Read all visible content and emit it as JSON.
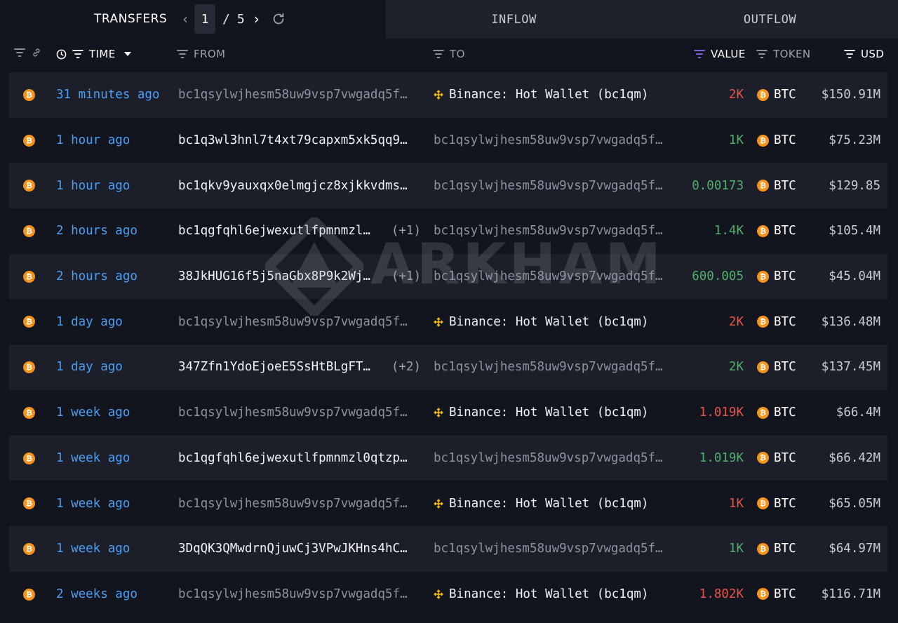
{
  "tabs": {
    "transfers_label": "TRANSFERS",
    "page_current": "1",
    "page_separator": "/",
    "page_total": "5",
    "inflow_label": "INFLOW",
    "outflow_label": "OUTFLOW"
  },
  "columns": {
    "time": "TIME",
    "from": "FROM",
    "to": "TO",
    "value": "VALUE",
    "token": "TOKEN",
    "usd": "USD"
  },
  "watermark": "ARKHAM",
  "colors": {
    "inflow_value": "#4fae6a",
    "outflow_value": "#e5534b",
    "time_link": "#4a9ff5",
    "btc": "#f7931a",
    "binance": "#f0b90b"
  },
  "rows": [
    {
      "time": "31 minutes ago",
      "from": "bc1qsylwjhesm58uw9vsp7vwgadq5f…",
      "from_extra": "",
      "from_style": "muted",
      "to": "Binance: Hot Wallet (bc1qm)",
      "to_is_entity": true,
      "to_style": "bright",
      "value": "2K",
      "direction": "out",
      "token": "BTC",
      "usd": "$150.91M"
    },
    {
      "time": "1 hour ago",
      "from": "bc1q3wl3hnl7t4xt79capxm5xk5qq9…",
      "from_extra": "",
      "from_style": "bright",
      "to": "bc1qsylwjhesm58uw9vsp7vwgadq5f…",
      "to_is_entity": false,
      "to_style": "muted",
      "value": "1K",
      "direction": "in",
      "token": "BTC",
      "usd": "$75.23M"
    },
    {
      "time": "1 hour ago",
      "from": "bc1qkv9yauxqx0elmgjcz8xjkkvdms…",
      "from_extra": "",
      "from_style": "bright",
      "to": "bc1qsylwjhesm58uw9vsp7vwgadq5f…",
      "to_is_entity": false,
      "to_style": "muted",
      "value": "0.00173",
      "direction": "in",
      "token": "BTC",
      "usd": "$129.85"
    },
    {
      "time": "2 hours ago",
      "from": "bc1qgfqhl6ejwexutlfpmnmzl…",
      "from_extra": "(+1)",
      "from_style": "bright",
      "to": "bc1qsylwjhesm58uw9vsp7vwgadq5f…",
      "to_is_entity": false,
      "to_style": "muted",
      "value": "1.4K",
      "direction": "in",
      "token": "BTC",
      "usd": "$105.4M"
    },
    {
      "time": "2 hours ago",
      "from": "38JkHUG16f5j5naGbx8P9k2Wj…",
      "from_extra": "(+1)",
      "from_style": "bright",
      "to": "bc1qsylwjhesm58uw9vsp7vwgadq5f…",
      "to_is_entity": false,
      "to_style": "muted",
      "value": "600.005",
      "direction": "in",
      "token": "BTC",
      "usd": "$45.04M"
    },
    {
      "time": "1 day ago",
      "from": "bc1qsylwjhesm58uw9vsp7vwgadq5f…",
      "from_extra": "",
      "from_style": "muted",
      "to": "Binance: Hot Wallet (bc1qm)",
      "to_is_entity": true,
      "to_style": "bright",
      "value": "2K",
      "direction": "out",
      "token": "BTC",
      "usd": "$136.48M"
    },
    {
      "time": "1 day ago",
      "from": "347Zfn1YdoEjoeE5SsHtBLgFT…",
      "from_extra": "(+2)",
      "from_style": "bright",
      "to": "bc1qsylwjhesm58uw9vsp7vwgadq5f…",
      "to_is_entity": false,
      "to_style": "muted",
      "value": "2K",
      "direction": "in",
      "token": "BTC",
      "usd": "$137.45M"
    },
    {
      "time": "1 week ago",
      "from": "bc1qsylwjhesm58uw9vsp7vwgadq5f…",
      "from_extra": "",
      "from_style": "muted",
      "to": "Binance: Hot Wallet (bc1qm)",
      "to_is_entity": true,
      "to_style": "bright",
      "value": "1.019K",
      "direction": "out",
      "token": "BTC",
      "usd": "$66.4M"
    },
    {
      "time": "1 week ago",
      "from": "bc1qgfqhl6ejwexutlfpmnmzl0qtzp…",
      "from_extra": "",
      "from_style": "bright",
      "to": "bc1qsylwjhesm58uw9vsp7vwgadq5f…",
      "to_is_entity": false,
      "to_style": "muted",
      "value": "1.019K",
      "direction": "in",
      "token": "BTC",
      "usd": "$66.42M"
    },
    {
      "time": "1 week ago",
      "from": "bc1qsylwjhesm58uw9vsp7vwgadq5f…",
      "from_extra": "",
      "from_style": "muted",
      "to": "Binance: Hot Wallet (bc1qm)",
      "to_is_entity": true,
      "to_style": "bright",
      "value": "1K",
      "direction": "out",
      "token": "BTC",
      "usd": "$65.05M"
    },
    {
      "time": "1 week ago",
      "from": "3DqQK3QMwdrnQjuwCj3VPwJKHns4hC…",
      "from_extra": "",
      "from_style": "bright",
      "to": "bc1qsylwjhesm58uw9vsp7vwgadq5f…",
      "to_is_entity": false,
      "to_style": "muted",
      "value": "1K",
      "direction": "in",
      "token": "BTC",
      "usd": "$64.97M"
    },
    {
      "time": "2 weeks ago",
      "from": "bc1qsylwjhesm58uw9vsp7vwgadq5f…",
      "from_extra": "",
      "from_style": "muted",
      "to": "Binance: Hot Wallet (bc1qm)",
      "to_is_entity": true,
      "to_style": "bright",
      "value": "1.802K",
      "direction": "out",
      "token": "BTC",
      "usd": "$116.71M"
    }
  ]
}
